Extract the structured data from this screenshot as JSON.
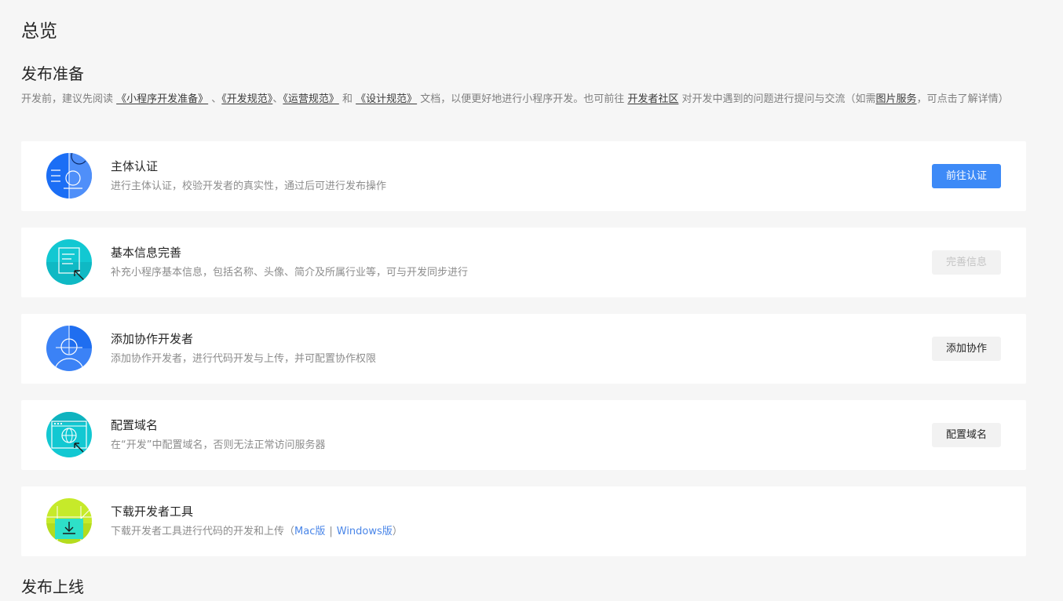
{
  "page_title": "总览",
  "prep_section": {
    "title": "发布准备",
    "intro": {
      "t1": "开发前，建议先阅读 ",
      "doc1": "《小程序开发准备》",
      "t2": " 、",
      "doc2": "《开发规范》",
      "t3": "、",
      "doc3": "《运营规范》",
      "t4": " 和 ",
      "doc4": "《设计规范》",
      "t5": " 文档，以便更好地进行小程序开发。也可前往 ",
      "community": "开发者社区",
      "t6": " 对开发中遇到的问题进行提问与交流（如需",
      "image_service": "图片服务",
      "t7": "，可点击了解详情）"
    },
    "steps": [
      {
        "title": "主体认证",
        "desc": "进行主体认证，校验开发者的真实性，通过后可进行发布操作",
        "button": "前往认证",
        "icon": "identity-verify-icon",
        "icon_color": "#1b6ef5"
      },
      {
        "title": "基本信息完善",
        "desc": "补充小程序基本信息，包括名称、头像、简介及所属行业等，可与开发同步进行",
        "button": "完善信息",
        "icon": "basic-info-icon",
        "icon_color": "#12c8d2"
      },
      {
        "title": "添加协作开发者",
        "desc": "添加协作开发者，进行代码开发与上传，并可配置协作权限",
        "button": "添加协作",
        "icon": "collaborator-icon",
        "icon_color": "#3b82f6"
      },
      {
        "title": "配置域名",
        "desc": "在“开发”中配置域名，否则无法正常访问服务器",
        "button": "配置域名",
        "icon": "domain-globe-icon",
        "icon_color": "#12c8d2"
      },
      {
        "title": "下载开发者工具",
        "desc_prefix": "下载开发者工具进行代码的开发和上传（",
        "mac_link": "Mac版",
        "separator": "|",
        "windows_link": "Windows版",
        "desc_suffix": "）",
        "icon": "download-tool-icon",
        "icon_color": "#c6ea2a"
      }
    ]
  },
  "publish_section": {
    "title": "发布上线"
  },
  "colors": {
    "primary": "#3d8af7",
    "link": "#4a86e8",
    "background": "#f6f6f6"
  }
}
